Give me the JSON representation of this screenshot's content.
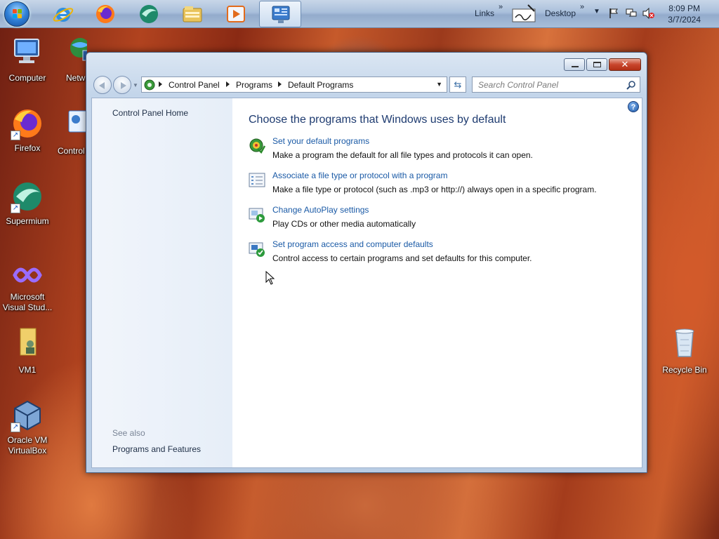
{
  "taskbar": {
    "links_label": "Links",
    "desktop_label": "Desktop",
    "clock_time": "8:09 PM",
    "clock_date": "3/7/2024",
    "pinned": [
      "internet-explorer-icon",
      "firefox-icon",
      "supermium-icon",
      "file-explorer-icon",
      "media-player-icon",
      "control-panel-icon"
    ]
  },
  "desktop": {
    "icons": [
      {
        "label": "Computer"
      },
      {
        "label": "Netw"
      },
      {
        "label": "Firefox"
      },
      {
        "label": "Control"
      },
      {
        "label": "Supermium"
      },
      {
        "label": "Microsoft Visual Stud..."
      },
      {
        "label": "VM1"
      },
      {
        "label": "Oracle VM VirtualBox"
      },
      {
        "label": "Recycle Bin"
      }
    ]
  },
  "window": {
    "breadcrumb": [
      "Control Panel",
      "Programs",
      "Default Programs"
    ],
    "search_placeholder": "Search Control Panel",
    "left": {
      "home_link": "Control Panel Home",
      "see_also": "See also",
      "programs_features": "Programs and Features"
    },
    "heading": "Choose the programs that Windows uses by default",
    "tasks": [
      {
        "link": "Set your default programs",
        "desc": "Make a program the default for all file types and protocols it can open.",
        "icon": "default-programs-icon"
      },
      {
        "link": "Associate a file type or protocol with a program",
        "desc": "Make a file type or protocol (such as .mp3 or http://) always open in a specific program.",
        "icon": "file-association-icon"
      },
      {
        "link": "Change AutoPlay settings",
        "desc": "Play CDs or other media automatically",
        "icon": "autoplay-icon"
      },
      {
        "link": "Set program access and computer defaults",
        "desc": "Control access to certain programs and set defaults for this computer.",
        "icon": "program-access-icon"
      }
    ]
  }
}
